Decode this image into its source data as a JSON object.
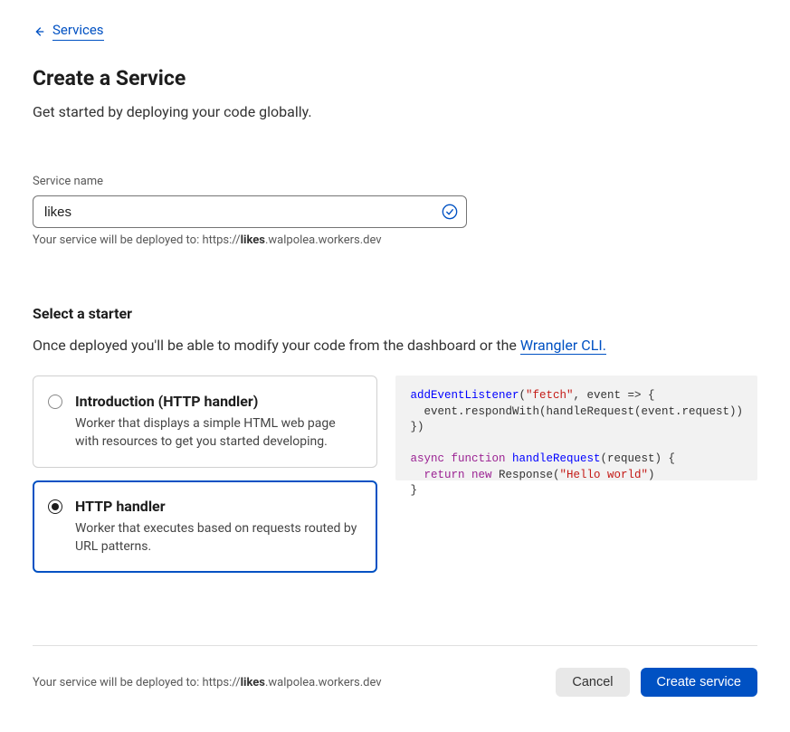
{
  "nav": {
    "back_label": "Services"
  },
  "header": {
    "title": "Create a Service",
    "subtitle": "Get started by deploying your code globally."
  },
  "form": {
    "service_name_label": "Service name",
    "service_name_value": "likes",
    "deploy_helper_prefix": "Your service will be deployed to: https://",
    "deploy_helper_bold": "likes",
    "deploy_helper_suffix": ".walpolea.workers.dev"
  },
  "starter": {
    "section_title": "Select a starter",
    "section_desc_prefix": "Once deployed you'll be able to modify your code from the dashboard or the ",
    "section_desc_link": "Wrangler CLI.",
    "options": [
      {
        "title": "Introduction (HTTP handler)",
        "desc": "Worker that displays a simple HTML web page with resources to get you started developing.",
        "selected": false
      },
      {
        "title": "HTTP handler",
        "desc": "Worker that executes based on requests routed by URL patterns.",
        "selected": true
      }
    ],
    "code": {
      "line1_fn": "addEventListener",
      "line1_str": "\"fetch\"",
      "line1_rest_a": ", event ",
      "line1_arrow": "=>",
      "line1_rest_b": " {",
      "line2": "  event.respondWith(handleRequest(event.request))",
      "line3": "})",
      "line5_kw1": "async",
      "line5_kw2": "function",
      "line5_fn": "handleRequest",
      "line5_rest": "(request) {",
      "line6_indent": "  ",
      "line6_kw1": "return",
      "line6_kw2": "new",
      "line6_rest_a": " Response(",
      "line6_str": "\"Hello world\"",
      "line6_rest_b": ")",
      "line7": "}"
    }
  },
  "footer": {
    "deploy_prefix": "Your service will be deployed to: https://",
    "deploy_bold": "likes",
    "deploy_suffix": ".walpolea.workers.dev",
    "cancel_label": "Cancel",
    "create_label": "Create service"
  }
}
